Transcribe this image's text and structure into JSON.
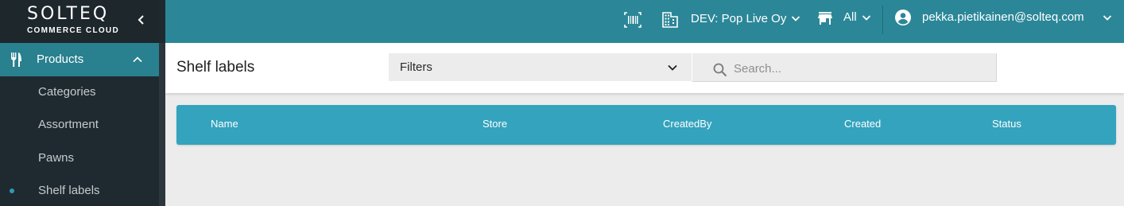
{
  "brand": {
    "name": "SOLTEQ",
    "subtitle": "COMMERCE CLOUD"
  },
  "sidebar": {
    "collapse_glyph": "‹",
    "parent": {
      "label": "Products",
      "icon": "cutlery-icon",
      "expanded": true
    },
    "items": [
      {
        "label": "Categories",
        "active": false
      },
      {
        "label": "Assortment",
        "active": false
      },
      {
        "label": "Pawns",
        "active": false
      },
      {
        "label": "Shelf labels",
        "active": true
      }
    ]
  },
  "topbar": {
    "barcode_icon": "barcode-icon",
    "company": {
      "icon": "building-icon",
      "label": "DEV: Pop Live Oy"
    },
    "store": {
      "icon": "store-icon",
      "label": "All"
    },
    "user": {
      "icon": "account-icon",
      "email": "pekka.pietikainen@solteq.com"
    }
  },
  "header": {
    "title": "Shelf labels",
    "filters_label": "Filters",
    "search_placeholder": "Search..."
  },
  "table": {
    "columns": [
      "Name",
      "Store",
      "CreatedBy",
      "Created",
      "Status"
    ],
    "rows": []
  },
  "colors": {
    "topbar": "#2b8798",
    "sidebar": "#1f2a30",
    "active_nav": "#29808f",
    "table_header": "#34a3bd"
  }
}
